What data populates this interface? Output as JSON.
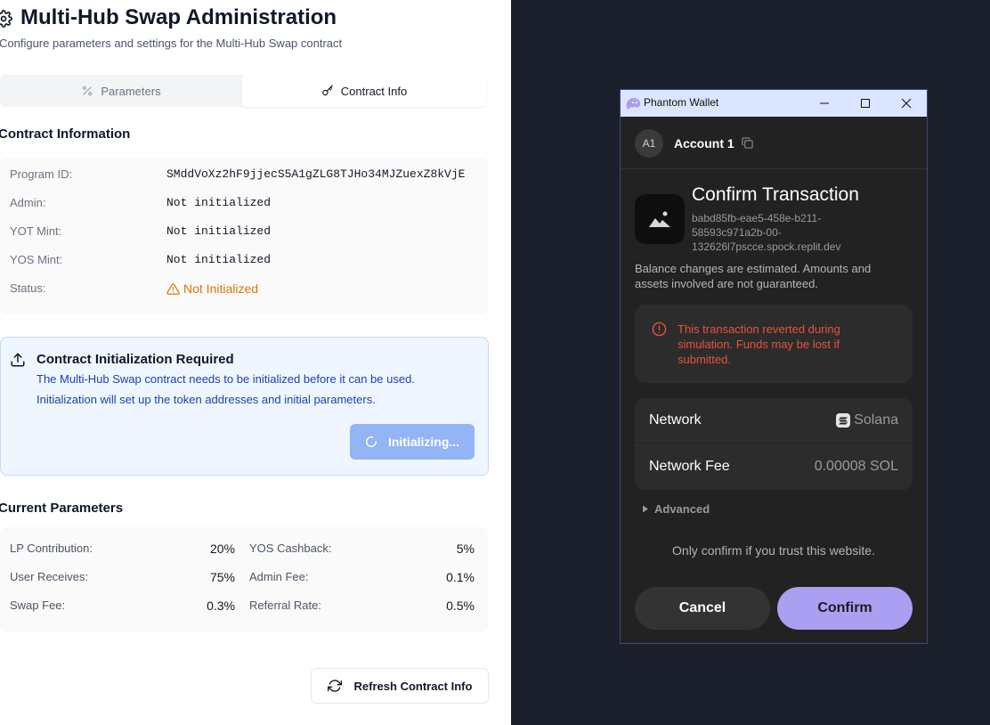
{
  "admin": {
    "title": "Multi-Hub Swap Administration",
    "subtitle": "Configure parameters and settings for the Multi-Hub Swap contract",
    "tabs": [
      {
        "label": "Parameters",
        "icon": "percent-icon",
        "active": false
      },
      {
        "label": "Contract Info",
        "icon": "key-icon",
        "active": true
      }
    ],
    "contract_info": {
      "heading": "Contract Information",
      "rows": [
        {
          "label": "Program ID:",
          "value": "SMddVoXz2hF9jjecS5A1gZLG8TJHo34MJZuexZ8kVjE"
        },
        {
          "label": "Admin:",
          "value": "Not initialized"
        },
        {
          "label": "YOT Mint:",
          "value": "Not initialized"
        },
        {
          "label": "YOS Mint:",
          "value": "Not initialized"
        }
      ],
      "status_label": "Status:",
      "status_value": "Not Initialized",
      "status_color": "#d97706"
    },
    "init_notice": {
      "title": "Contract Initialization Required",
      "line1": "The Multi-Hub Swap contract needs to be initialized before it can be used.",
      "line2": "Initialization will set up the token addresses and initial parameters.",
      "button_label": "Initializing..."
    },
    "current_params": {
      "heading": "Current Parameters",
      "left": [
        {
          "label": "LP Contribution:",
          "value": "20%"
        },
        {
          "label": "User Receives:",
          "value": "75%"
        },
        {
          "label": "Swap Fee:",
          "value": "0.3%"
        }
      ],
      "right": [
        {
          "label": "YOS Cashback:",
          "value": "5%"
        },
        {
          "label": "Admin Fee:",
          "value": "0.1%"
        },
        {
          "label": "Referral Rate:",
          "value": "0.5%"
        }
      ]
    },
    "refresh_label": "Refresh Contract Info"
  },
  "wallet": {
    "window_title": "Phantom Wallet",
    "account_avatar": "A1",
    "account_name": "Account 1",
    "heading": "Confirm Transaction",
    "origin_lines": [
      "babd85fb-eae5-458e-b211-",
      "58593c971a2b-00-",
      "132626l7pscce.spock.replit.dev"
    ],
    "notice_lines": [
      "Balance changes are estimated. Amounts and",
      "assets involved are not guaranteed."
    ],
    "warning_lines": [
      "This transaction reverted during",
      "simulation. Funds may be lost if",
      "submitted."
    ],
    "warning_color": "#e5533b",
    "network_label": "Network",
    "network_value": "Solana",
    "fee_label": "Network Fee",
    "fee_value": "0.00008 SOL",
    "advanced_label": "Advanced",
    "trust_text": "Only confirm if you trust this website.",
    "cancel_label": "Cancel",
    "confirm_label": "Confirm",
    "accent_color": "#ab9ff2"
  }
}
